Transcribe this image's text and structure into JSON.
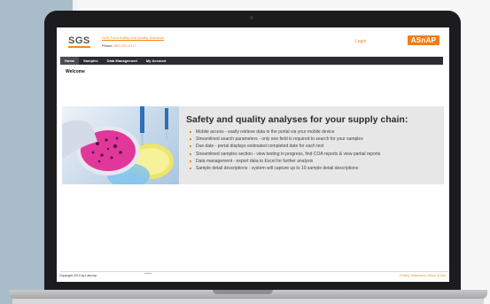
{
  "header": {
    "logo": "SGS",
    "link_text": "SGS Food Safety and Quality Solutions",
    "phone_label": "Phone:",
    "phone_number": "800-222-0717",
    "login": "Login",
    "brand_logo": "ASnAP"
  },
  "nav": {
    "items": [
      {
        "label": "Home",
        "active": true
      },
      {
        "label": "Samples",
        "active": false
      },
      {
        "label": "Data Management",
        "active": false
      },
      {
        "label": "My Account",
        "active": false
      }
    ]
  },
  "main": {
    "heading": "Welcome",
    "banner": {
      "title": "Safety and quality analyses for your supply chain:",
      "bullets": [
        "Mobile access - easily retrieve data in the portal via your mobile device",
        "Streamlined search parameters - only one field is required to search for your samples",
        "Due date - portal displays estimated completed date for each test",
        "Streamlined samples section - view testing in progress, find COA reports & view partial reports",
        "Data management - export data to Excel for further analysis",
        "Sample detail descriptions - system will capture up to 10 sample detail descriptions"
      ]
    }
  },
  "footer": {
    "copyright": "Copyright 2013 by Labcorp",
    "links": "Privacy Statement | Terms of Use"
  },
  "colors": {
    "accent": "#f08a1c",
    "nav_bg": "#2d2b33",
    "laptop_bezel": "#1c1c1e",
    "backdrop": "#a9bcc9"
  }
}
